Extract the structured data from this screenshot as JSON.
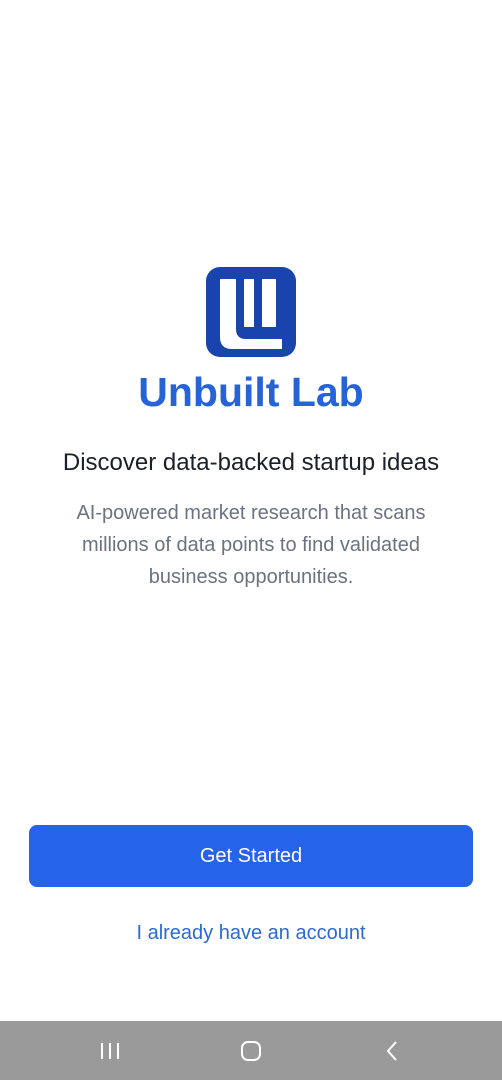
{
  "app": {
    "name": "Unbuilt Lab",
    "logo_icon": "unbuilt-lab-logo-icon",
    "brand_color": "#2563d6"
  },
  "hero": {
    "headline": "Discover data-backed startup ideas",
    "description": "AI-powered market research that scans millions of data points to find validated business opportunities."
  },
  "actions": {
    "primary_label": "Get Started",
    "primary_color": "#2563e8",
    "secondary_label": "I already have an account"
  },
  "navigation_bar": {
    "recents_icon": "recent-apps-icon",
    "home_icon": "home-icon",
    "back_icon": "back-icon"
  }
}
